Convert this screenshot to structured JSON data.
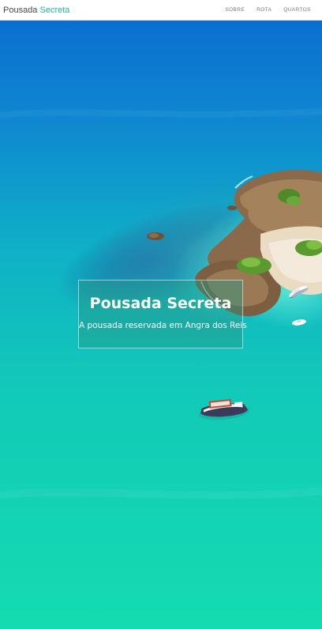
{
  "navbar": {
    "brand": {
      "first": "Pousada",
      "second": "Secreta"
    },
    "links": [
      {
        "label": "SOBRE"
      },
      {
        "label": "ROTA"
      },
      {
        "label": "QUARTOS"
      }
    ]
  },
  "hero": {
    "title": "Pousada Secreta",
    "subtitle": "A pousada reservada em Angra dos Reis",
    "image": "aerial-island-turquoise-sea-photo"
  },
  "colors": {
    "accent": "#1fb7a6",
    "deep_sea": "#0a72d0",
    "shallow_sea": "#10d6b4",
    "nav_text": "#777777"
  }
}
